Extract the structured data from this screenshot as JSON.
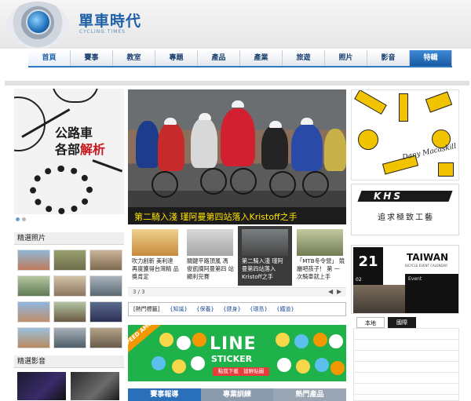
{
  "header": {
    "site_title": "單車時代",
    "site_subtitle": "CYCLING TIMES",
    "logo_icon": "globe-icon"
  },
  "nav": {
    "items": [
      "首頁",
      "賽事",
      "教室",
      "專題",
      "產品",
      "產業",
      "旅遊",
      "照片",
      "影音",
      "特輯"
    ]
  },
  "left": {
    "promo_title_line1": "公路車",
    "promo_title_line2_a": "各部",
    "promo_title_line2_b": "解析",
    "featured_photos_label": "精選照片",
    "featured_videos_label": "精選影音"
  },
  "slider": {
    "caption": "第二騎入淺 瑾阿曼第四站落入Kristoff之手"
  },
  "news": [
    {
      "text": "吹力創新 美利達 再度獲得台灣精 品獎肯定"
    },
    {
      "text": "關鍵平路頂風 馮 俊凱摘阿曼第四 站顯利完賽"
    },
    {
      "text": "第二騎入淺 瑾阿 曼第四站落入 Kristoff之手"
    },
    {
      "text": "「MTB冬令營」 競廳吧孩子！ 第 一次騎車就上手"
    }
  ],
  "pager": {
    "text": "3 / 3",
    "prev_icon": "chevron-left-icon",
    "next_icon": "chevron-right-icon"
  },
  "tags": {
    "label": "[熱門標籤]",
    "items": [
      "{知識}",
      "{保養}",
      "{健身}",
      "{環島}",
      "{鐵道}"
    ]
  },
  "line_ad": {
    "corner": "SPEED AMON",
    "logo": "LINE",
    "subtitle": "STICKER",
    "button": "點我下載　搶鮮貼圖"
  },
  "bottom_tabs": [
    "賽事報導",
    "專業訓練",
    "熱門產品"
  ],
  "right": {
    "signature": "Dany Macaskill",
    "khs_logo": "KHS",
    "khs_slogan": "追求極致工藝",
    "taiwan_day": "21",
    "taiwan_month": "02",
    "taiwan_logo": "TAIWAN",
    "taiwan_sub": "BICYCLE EVENT CALENDAR",
    "taiwan_event": "Event",
    "tabs": [
      "本地",
      "國際"
    ]
  },
  "colors": {
    "brand_blue": "#1e5fa8",
    "nav_active": "#2f78c2",
    "caption_yellow": "#ffe400",
    "line_green": "#1fb24b",
    "brake_yellow": "#f2c400"
  }
}
